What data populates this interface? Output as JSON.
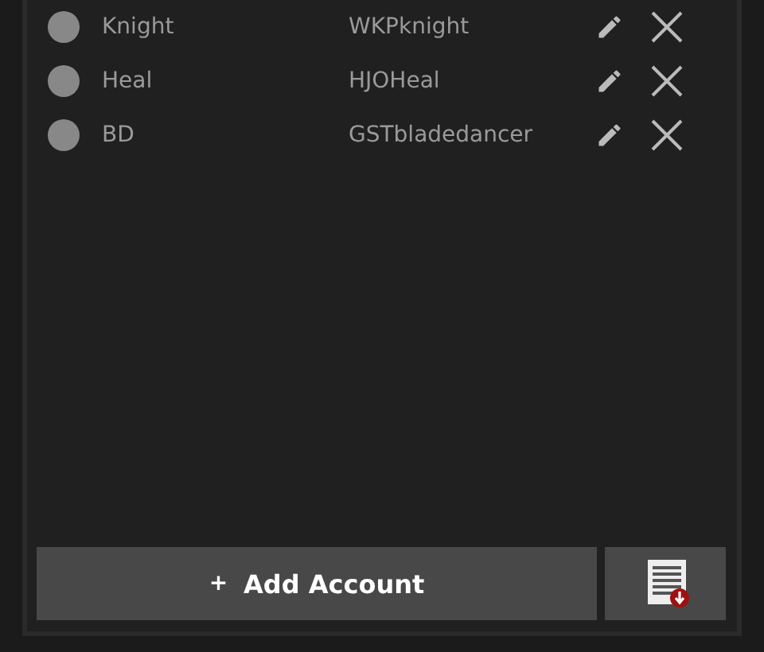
{
  "accounts": [
    {
      "name": "Knight",
      "account": "WKPknight"
    },
    {
      "name": "Heal",
      "account": "HJOHeal"
    },
    {
      "name": "BD",
      "account": "GSTbladedancer"
    }
  ],
  "add_button": {
    "icon": "+",
    "label": "Add Account"
  }
}
